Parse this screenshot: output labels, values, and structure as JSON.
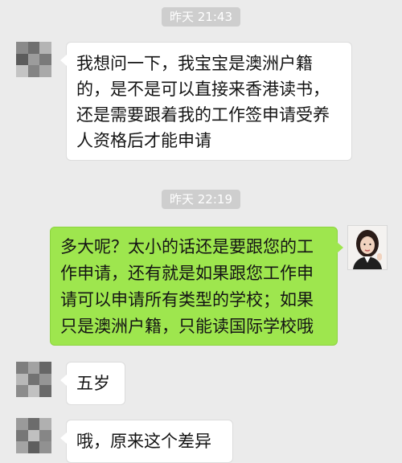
{
  "colors": {
    "background": "#ebebeb",
    "timestamp_bg": "#cecece",
    "bubble_received": "#ffffff",
    "bubble_sent": "#9ee64e"
  },
  "timestamps": [
    "昨天 21:43",
    "昨天 22:19"
  ],
  "messages": [
    {
      "side": "left",
      "lines": [
        "我想问一下，我宝宝是澳洲户籍",
        "的，是不是可以直接来香港读书，",
        "还是需要跟着我的工作签申请受养",
        "人资格后才能申请"
      ]
    },
    {
      "side": "right",
      "lines": [
        "多大呢？太小的话还是要跟您的工",
        "作申请，还有就是如果跟您工作申",
        "请可以申请所有类型的学校；如果",
        "只是澳洲户籍，只能读国际学校哦"
      ]
    },
    {
      "side": "left",
      "lines": [
        "五岁"
      ]
    },
    {
      "side": "left",
      "lines": [
        "哦，原来这个差异"
      ]
    }
  ]
}
